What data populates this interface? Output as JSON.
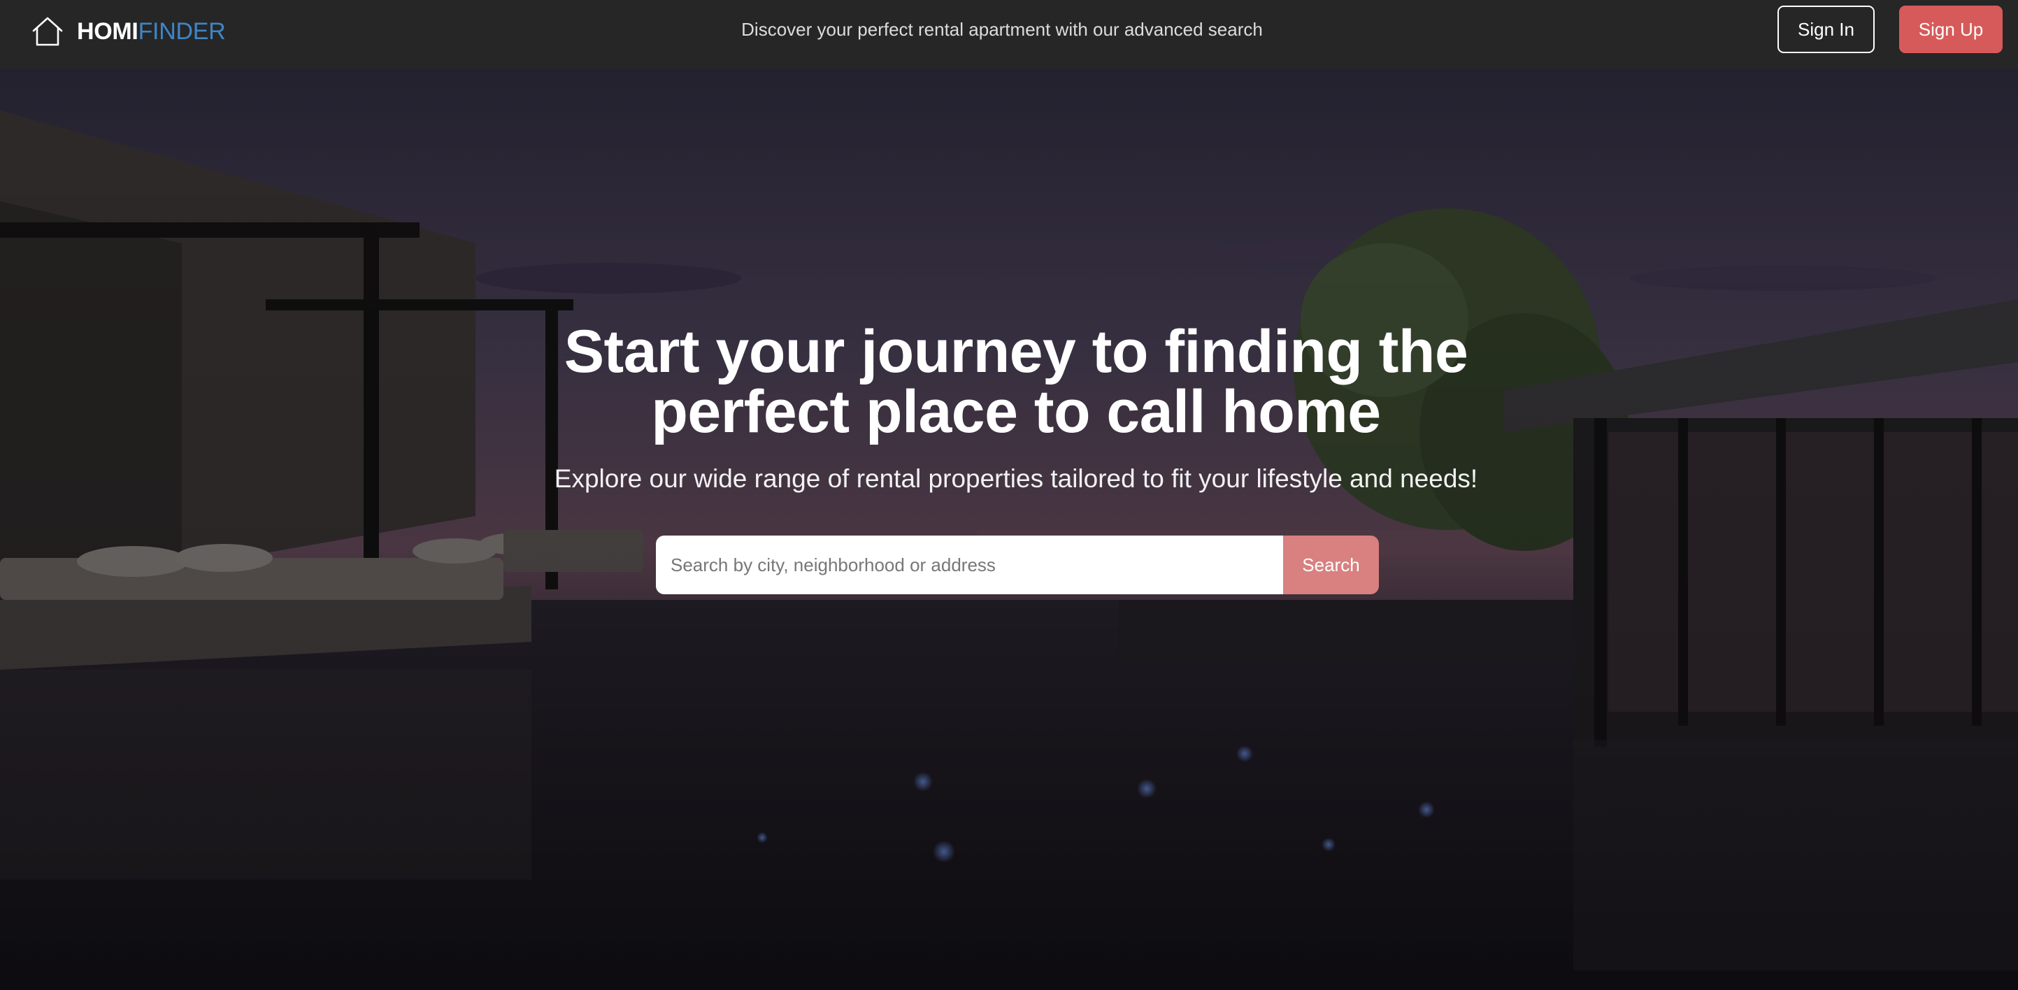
{
  "brand": {
    "part1": "HOMI",
    "part2": "FINDER",
    "icon": "house-outline-icon"
  },
  "header": {
    "tagline": "Discover your perfect rental apartment with our advanced search"
  },
  "auth": {
    "signin_label": "Sign In",
    "signup_label": "Sign Up"
  },
  "hero": {
    "title": "Start your journey to finding the perfect place to call home",
    "subtitle": "Explore our wide range of rental properties tailored to fit your lifestyle and needs!",
    "search": {
      "placeholder": "Search by city, neighborhood or address",
      "value": "",
      "button_label": "Search"
    }
  },
  "colors": {
    "navbar": "#262626",
    "accent_blue": "#3f85c6",
    "signup_red": "#d75a5a",
    "search_button": "#d98080"
  }
}
